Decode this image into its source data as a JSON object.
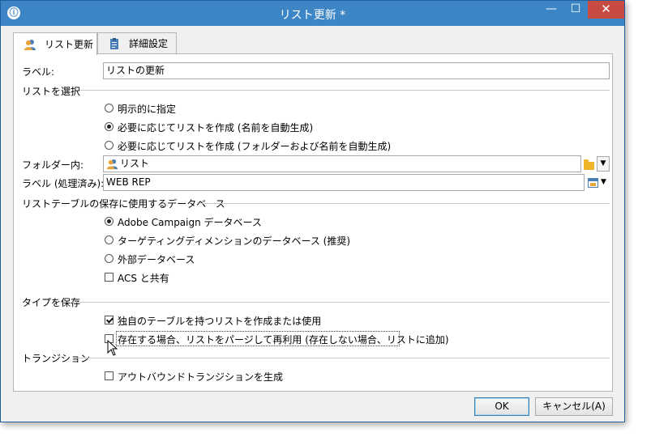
{
  "window": {
    "title": "リスト更新 *",
    "controls": {
      "minimize": "—",
      "maximize": "☐",
      "close": "✕"
    }
  },
  "tabs": [
    {
      "label": "リスト更新",
      "icon": "users-icon",
      "active": true
    },
    {
      "label": "詳細設定",
      "icon": "clipboard-icon",
      "active": false
    }
  ],
  "form": {
    "label_field": {
      "label": "ラベル:",
      "value": "リストの更新"
    },
    "select_list": {
      "section": "リストを選択",
      "options": [
        {
          "label": "明示的に指定",
          "checked": false
        },
        {
          "label": "必要に応じてリストを作成 (名前を自動生成)",
          "checked": true
        },
        {
          "label": "必要に応じてリストを作成 (フォルダーおよび名前を自動生成)",
          "checked": false
        }
      ]
    },
    "folder_field": {
      "label": "フォルダー内:",
      "value": "リスト"
    },
    "processed_label_field": {
      "label": "ラベル (処理済み):",
      "value": "WEB REP"
    },
    "storage": {
      "section": "リストテーブルの保存に使用するデータベース",
      "options": [
        {
          "label": "Adobe Campaign データベース",
          "checked": true
        },
        {
          "label": "ターゲティングディメンションのデータベース (推奨)",
          "checked": false
        },
        {
          "label": "外部データベース",
          "checked": false
        }
      ],
      "share_acs": {
        "label": "ACS と共有",
        "checked": false
      }
    },
    "save_type": {
      "section": "タイプを保存",
      "own_table": {
        "label": "独自のテーブルを持つリストを作成または使用",
        "checked": true
      },
      "purge_reuse": {
        "label": "存在する場合、リストをパージして再利用 (存在しない場合、リストに追加)",
        "checked": false
      }
    },
    "transition": {
      "section": "トランジション",
      "outbound": {
        "label": "アウトバウンドトランジションを生成",
        "checked": false
      }
    }
  },
  "buttons": {
    "ok": "OK",
    "cancel": "キャンセル(A)"
  },
  "colors": {
    "titlebar": "#3d86c6",
    "close_button": "#c74b42",
    "window_bg": "#f0f0f0"
  }
}
